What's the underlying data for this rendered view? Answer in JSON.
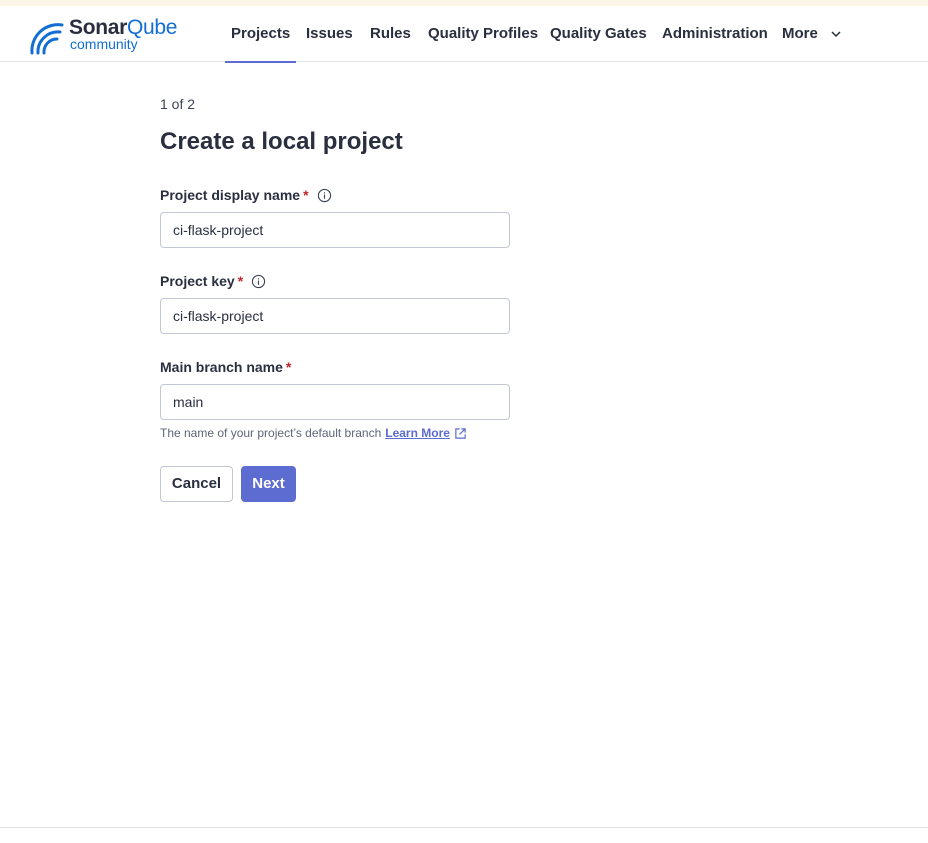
{
  "app": {
    "logo_brand_a": "Sonar",
    "logo_brand_b": "Qube",
    "logo_edition": "community"
  },
  "nav": {
    "items": [
      {
        "label": "Projects",
        "active": true
      },
      {
        "label": "Issues"
      },
      {
        "label": "Rules"
      },
      {
        "label": "Quality Profiles"
      },
      {
        "label": "Quality Gates"
      },
      {
        "label": "Administration"
      },
      {
        "label": "More",
        "icon": "chevron-down-icon"
      }
    ]
  },
  "form": {
    "step": "1 of 2",
    "title": "Create a local project",
    "required_mark": "*",
    "display_name": {
      "label": "Project display name",
      "value": "ci-flask-project",
      "icon": "info-icon"
    },
    "project_key": {
      "label": "Project key",
      "value": "ci-flask-project",
      "icon": "info-icon"
    },
    "main_branch": {
      "label": "Main branch name",
      "value": "main",
      "hint": "The name of your project’s default branch",
      "link": "Learn More",
      "link_icon": "external-link-icon"
    },
    "cancel_label": "Cancel",
    "next_label": "Next"
  },
  "colors": {
    "accent": "#5d6cd0",
    "brand_blue": "#126ed3",
    "required": "#c0272c",
    "top_banner": "#fdf6e6"
  }
}
